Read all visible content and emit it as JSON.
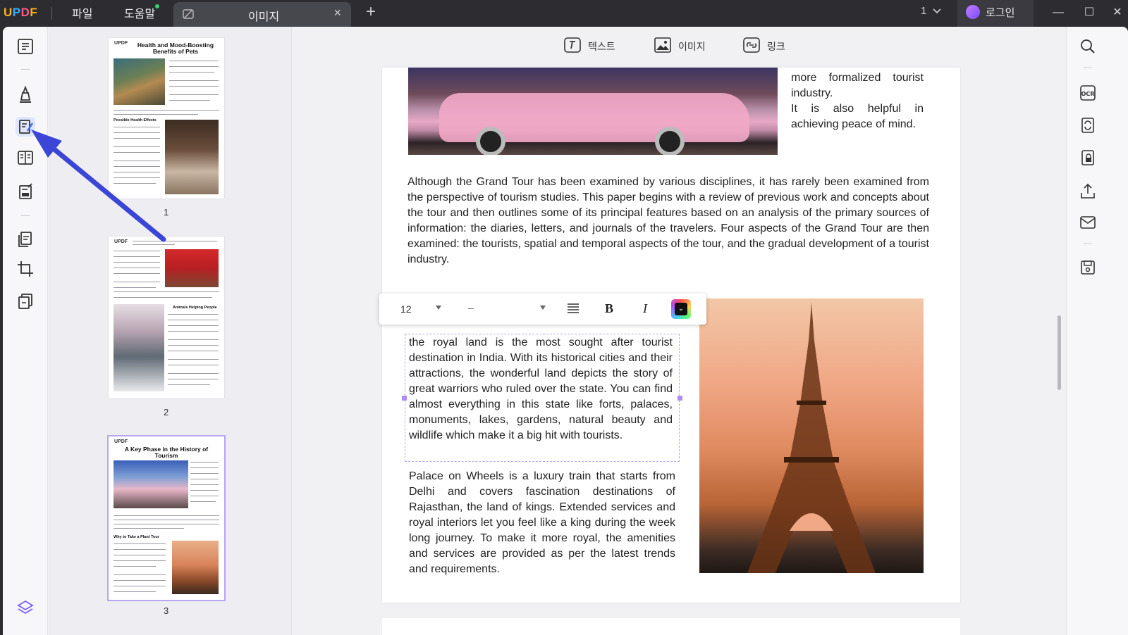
{
  "app": {
    "logo": "UPDF",
    "menus": [
      "파일",
      "도움말"
    ],
    "tab_label": "이미지",
    "tab_close": "×",
    "new_tab": "+",
    "page_indicator": "1",
    "login_label": "로그인",
    "window_controls": [
      "minimize-icon",
      "maximize-icon",
      "close-icon"
    ]
  },
  "left_tools": [
    "reader-icon",
    "comment-icon",
    "edit-pdf-icon",
    "page-view-icon",
    "fill-sign-icon",
    "organize-pages-icon",
    "crop-icon",
    "batch-icon",
    "layers-icon"
  ],
  "thumbnails": [
    {
      "number": "1",
      "logo": "UPDF",
      "title": "Health and Mood-Boosting Benefits of Pets",
      "subheading": "Possible Health Effects"
    },
    {
      "number": "2",
      "logo": "UPDF",
      "title": "",
      "subheading": "Animals Helping People"
    },
    {
      "number": "3",
      "logo": "UPDF",
      "title": "A Key Phase in the History of Tourism",
      "subheading": "Why to Take a Plant Tour"
    }
  ],
  "edit_toolbar": {
    "text": "텍스트",
    "image": "이미지",
    "link": "링크"
  },
  "page": {
    "right_snippet": "more formalized tourist industry.\nIt is also helpful in achieving peace of mind.",
    "para1": "Although the Grand Tour has been examined by various disciplines, it has rarely been examined from the perspective of tourism studies. This paper begins with a review of previous work and concepts about the tour and then outlines some of its principal features based on an analysis of the primary sources of information: the diaries, letters, and journals of the travelers. Four aspects of the Grand Tour are then examined: the tourists, spatial and temporal aspects of the tour, and the gradual development of a tourist industry.",
    "selected_text": "the royal land is the most sought after tourist destination in India. With its historical cities and their attractions, the wonderful land depicts the story of great warriors who ruled over the state. You can find almost everything in this state like forts, palaces, monuments, lakes, gardens, natural beauty and wildlife which make it a big hit with tourists.",
    "para3": "Palace on Wheels is a luxury train that starts from Delhi and covers fascination destinations of Rajasthan, the land of kings. Extended services and royal interiors let you feel like a king during the week long journey. To make it more royal, the amenities and services are provided as per the latest trends and requirements."
  },
  "format_bar": {
    "font_size": "12",
    "font_name": "–",
    "bold": "B",
    "italic": "I",
    "color_chevron": "⌄"
  },
  "right_tools": [
    "search-icon",
    "ocr-icon",
    "convert-icon",
    "protect-icon",
    "share-icon",
    "email-icon",
    "save-icon"
  ]
}
